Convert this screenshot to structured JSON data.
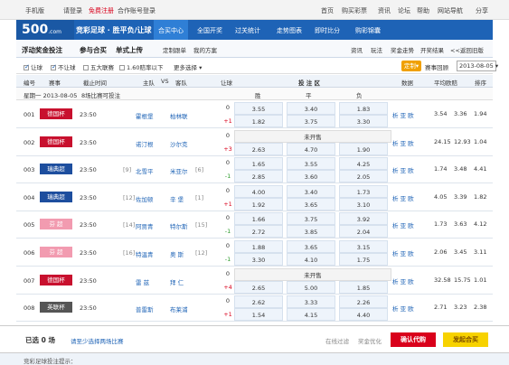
{
  "topbar": {
    "mobile": "手机版",
    "please_login": "请登录",
    "free_register": "免费注册",
    "partner_login": "合作账号登录",
    "home": "首页",
    "buy_lottery": "购买彩票",
    "news": "资讯",
    "forum": "论坛",
    "help": "帮助",
    "site_nav": "网站导航",
    "share": "分享"
  },
  "logo": {
    "text": "500",
    "sub": ".com"
  },
  "brand": "竞彩足球 · 胜平负/让球",
  "nav": [
    "合买中心",
    "全国开奖",
    "过关统计",
    "走势图表",
    "即时比分",
    "购彩锦囊"
  ],
  "subnav": {
    "float_bonus": "浮动奖金投注",
    "join_buy": "参与合买",
    "single_upload": "单式上传",
    "custom_follow": "定制跟单",
    "my_plan": "我的方案",
    "right_links": [
      "资讯",
      "玩法",
      "奖金走势",
      "开奖结果",
      "&lt;&lt;返回旧版"
    ]
  },
  "filter": {
    "rangqiu": "让球",
    "bu_rangqiu": "不让球",
    "five_leagues": "五大联赛",
    "odds_below": "1.60赔率以下",
    "more": "更多选择",
    "ding": "定制",
    "match_review": "赛事回顾",
    "date": "2013-08-05"
  },
  "thead": [
    "编号",
    "赛事",
    "截止时间",
    "主队",
    "VS",
    "客队",
    "让球",
    "投 注 区",
    "数据",
    "平均欧赔",
    "排序"
  ],
  "subhead": {
    "win": "胜",
    "draw": "平",
    "lose": "负"
  },
  "daterow": {
    "date": "星期一  2013-08-05",
    "count": "8场比赛可投注"
  },
  "matches": [
    {
      "no": "001",
      "league": "德国杯",
      "league_color": "#c8102e",
      "time": "23:50",
      "home": "霍根堡",
      "away": "柏林联",
      "rank_home": "",
      "rank_away": "",
      "h1": "0",
      "o1": [
        "3.55",
        "3.40",
        "1.83"
      ],
      "h2": "+1",
      "o2": [
        "1.82",
        "3.75",
        "3.30"
      ],
      "data": "析 亚 欧",
      "avg": [
        "3.54",
        "3.36",
        "1.94"
      ]
    },
    {
      "no": "002",
      "league": "德国杯",
      "league_color": "#c8102e",
      "time": "23:50",
      "home": "诺汀根",
      "away": "沙尔克",
      "rank_home": "",
      "rank_away": "",
      "h1": "0",
      "o1": [
        "未开售"
      ],
      "h2": "+3",
      "o2": [
        "2.63",
        "4.70",
        "1.90"
      ],
      "data": "析 亚 欧",
      "avg": [
        "24.15",
        "12.93",
        "1.04"
      ]
    },
    {
      "no": "003",
      "league": "瑞典超",
      "league_color": "#1d4e9e",
      "time": "23:50",
      "home": "北雪平",
      "away": "米亚尔",
      "rank_home": "[9]",
      "rank_away": "[6]",
      "h1": "0",
      "o1": [
        "1.65",
        "3.55",
        "4.25"
      ],
      "h2": "-1",
      "o2": [
        "2.85",
        "3.60",
        "2.05"
      ],
      "data": "析 亚 欧",
      "avg": [
        "1.74",
        "3.48",
        "4.41"
      ]
    },
    {
      "no": "004",
      "league": "瑞典超",
      "league_color": "#1d4e9e",
      "time": "23:50",
      "home": "佐加顿",
      "away": "辛 堡",
      "rank_home": "[12]",
      "rank_away": "[1]",
      "h1": "0",
      "o1": [
        "4.00",
        "3.40",
        "1.73"
      ],
      "h2": "+1",
      "o2": [
        "1.92",
        "3.65",
        "3.10"
      ],
      "data": "析 亚 欧",
      "avg": [
        "4.05",
        "3.39",
        "1.82"
      ]
    },
    {
      "no": "005",
      "league": "芬 超",
      "league_color": "#f29bb0",
      "time": "23:50",
      "home": "阿贾青",
      "away": "特尔斯",
      "rank_home": "[14]",
      "rank_away": "[15]",
      "h1": "0",
      "o1": [
        "1.66",
        "3.75",
        "3.92"
      ],
      "h2": "-1",
      "o2": [
        "2.72",
        "3.85",
        "2.04"
      ],
      "data": "析 亚 欧",
      "avg": [
        "1.73",
        "3.63",
        "4.12"
      ]
    },
    {
      "no": "006",
      "league": "芬 超",
      "league_color": "#f29bb0",
      "time": "23:50",
      "home": "特温青",
      "away": "奥 斯",
      "rank_home": "[16]",
      "rank_away": "[12]",
      "h1": "0",
      "o1": [
        "1.88",
        "3.65",
        "3.15"
      ],
      "h2": "-1",
      "o2": [
        "3.30",
        "4.10",
        "1.75"
      ],
      "data": "析 亚 欧",
      "avg": [
        "2.06",
        "3.45",
        "3.11"
      ]
    },
    {
      "no": "007",
      "league": "德国杯",
      "league_color": "#c8102e",
      "time": "23:50",
      "home": "雷 兹",
      "away": "拜 仁",
      "rank_home": "",
      "rank_away": "",
      "h1": "0",
      "o1": [
        "未开售"
      ],
      "h2": "+4",
      "o2": [
        "2.65",
        "5.00",
        "1.85"
      ],
      "data": "析 亚 欧",
      "avg": [
        "32.58",
        "15.75",
        "1.01"
      ]
    },
    {
      "no": "008",
      "league": "英联杯",
      "league_color": "#555555",
      "time": "23:50",
      "home": "普雷斯",
      "away": "布莱浦",
      "rank_home": "",
      "rank_away": "",
      "h1": "0",
      "o1": [
        "2.62",
        "3.33",
        "2.26"
      ],
      "h2": "+1",
      "o2": [
        "1.54",
        "4.15",
        "4.40"
      ],
      "data": "析 亚 欧",
      "avg": [
        "2.71",
        "3.23",
        "2.38"
      ]
    }
  ],
  "footer": {
    "selected": "已选 0 场",
    "tip": "请至少选择两场比赛",
    "online_filter": "在线过滤",
    "bonus_opt": "奖金优化",
    "confirm": "确认代购",
    "hemai": "发起合买"
  },
  "bottom": "竞彩足球投注提示："
}
